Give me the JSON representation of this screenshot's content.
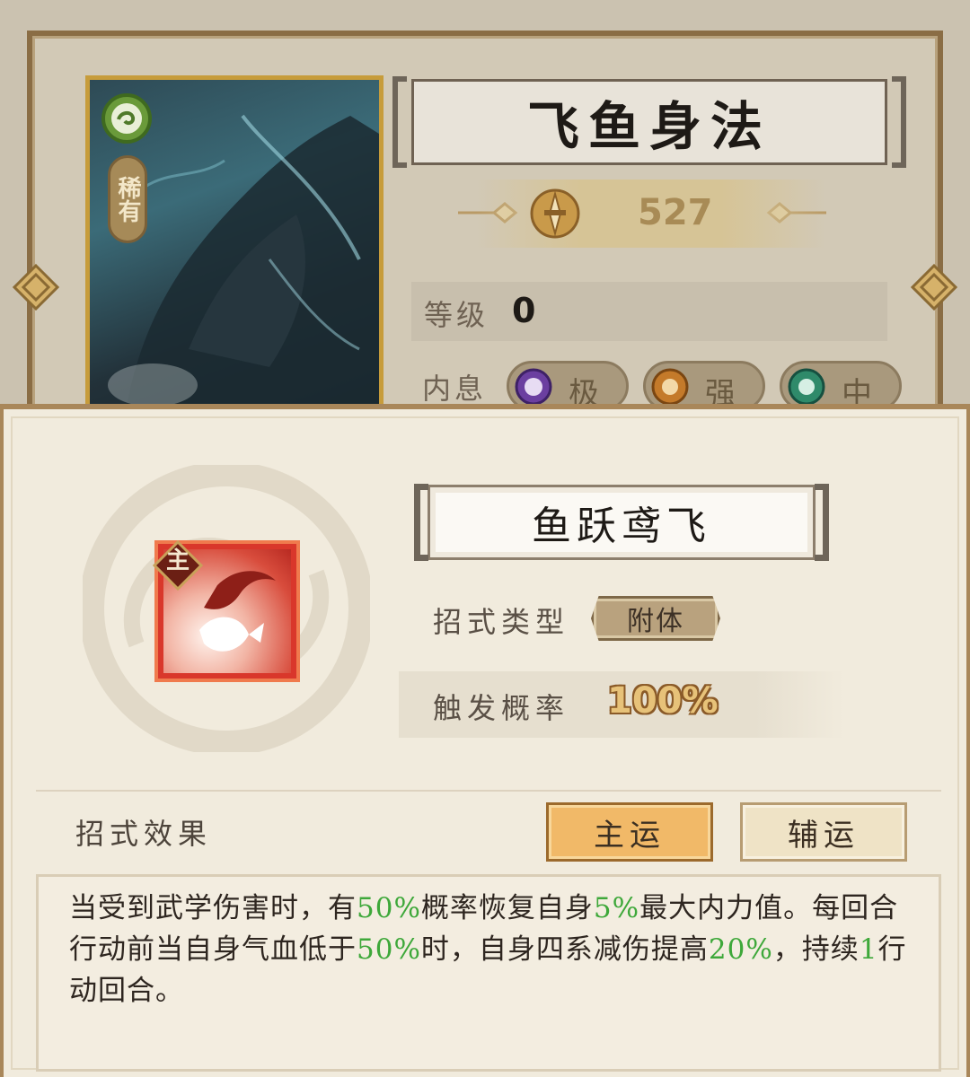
{
  "card": {
    "name": "飞鱼身法",
    "rarity": "稀有",
    "power": "527",
    "level_label": "等级",
    "level_value": "0",
    "neixi_label": "内息",
    "neixi": [
      {
        "label": "极",
        "color": "#6b3fa0"
      },
      {
        "label": "强",
        "color": "#c47a2a"
      },
      {
        "label": "中",
        "color": "#2f8a6a"
      }
    ]
  },
  "move": {
    "name": "鱼跃鸢飞",
    "role_badge": "主",
    "type_label": "招式类型",
    "type_value": "附体",
    "rate_label": "触发概率",
    "rate_value": "100%"
  },
  "effect": {
    "label": "招式效果",
    "tabs": [
      {
        "label": "主运",
        "active": true
      },
      {
        "label": "辅运",
        "active": false
      }
    ],
    "parts": [
      {
        "text": "当受到武学伤害时，有",
        "hl": false
      },
      {
        "text": "50%",
        "hl": true
      },
      {
        "text": "概率恢复自身",
        "hl": false
      },
      {
        "text": "5%",
        "hl": true
      },
      {
        "text": "最大内力值。每回合行动前当自身气血低于",
        "hl": false
      },
      {
        "text": "50%",
        "hl": true
      },
      {
        "text": "时，自身四系减伤提高",
        "hl": false
      },
      {
        "text": "20%",
        "hl": true
      },
      {
        "text": "，持续",
        "hl": false
      },
      {
        "text": "1",
        "hl": true
      },
      {
        "text": "行动回合。",
        "hl": false
      }
    ]
  },
  "colors": {
    "highlight": "#3ea83a",
    "active_tab": "#f1b968",
    "frame": "#a9875a"
  }
}
